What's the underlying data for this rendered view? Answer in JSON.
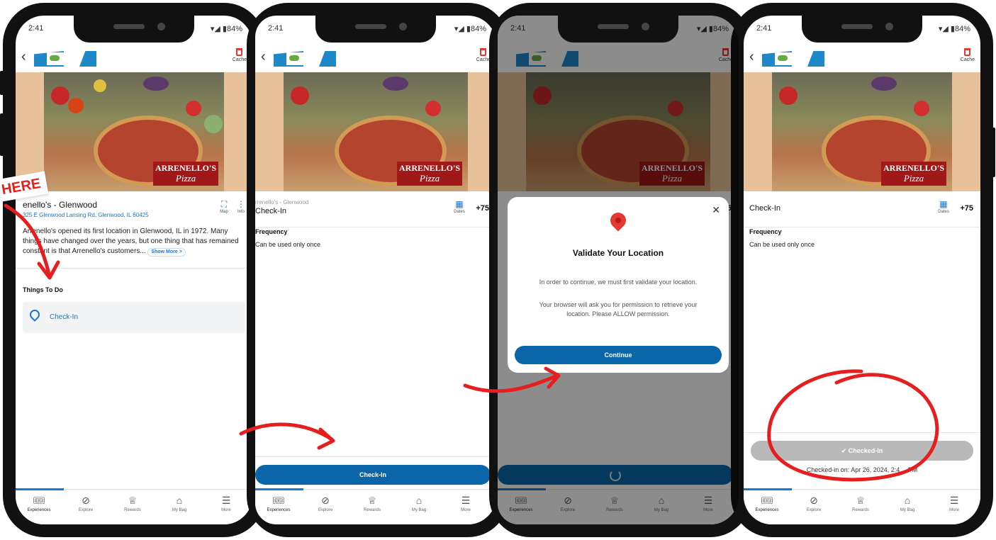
{
  "status": {
    "time": "2:41",
    "battery": "84%"
  },
  "header": {
    "cache_label": "Cache"
  },
  "hero": {
    "brand_line1": "ARRENELLO'S",
    "brand_line2": "Pizza"
  },
  "location": {
    "name": "Arrenello's - Glenwood",
    "name_visible": "enello's - Glenwood",
    "address": "325 E Glenwood Lansing Rd, Glenwood, IL 60425",
    "description": "Arrenello's opened its first location in Glenwood, IL in 1972. Many things have changed over the years, but one thing that has remained constant is that Arrenello's customers...",
    "show_more": "Show More >",
    "map_label": "Map",
    "info_label": "Info"
  },
  "things_to_do": {
    "title": "Things To Do",
    "items": [
      {
        "label": "Check-In"
      }
    ]
  },
  "checkin": {
    "subtitle": "rrenello's - Glenwood",
    "title": "Check-In",
    "dates_label": "Dates",
    "points": "+75",
    "frequency_label": "Frequency",
    "frequency_value": "Can be used only once",
    "button": "Check-In",
    "checked_button": "Checked-In",
    "checked_on": "Checked-in on: Apr 26, 2024, 2:4… PM"
  },
  "modal": {
    "title": "Validate Your Location",
    "p1": "In order to continue, we must first validate your location.",
    "p2": "Your browser will ask you for permission to retrieve your location. Please ALLOW permission.",
    "button": "Continue"
  },
  "tabs": [
    {
      "label": "Experiences",
      "icon": "ticket-icon"
    },
    {
      "label": "Explore",
      "icon": "compass-icon"
    },
    {
      "label": "Rewards",
      "icon": "trophy-icon"
    },
    {
      "label": "My Bag",
      "icon": "bag-icon"
    },
    {
      "label": "More",
      "icon": "menu-icon"
    }
  ],
  "annotation": {
    "here": "HERE"
  },
  "colors": {
    "primary": "#0a66a9",
    "link": "#1976d2",
    "annotation_red": "#e61e1e",
    "disabled": "#b9b9b9"
  }
}
